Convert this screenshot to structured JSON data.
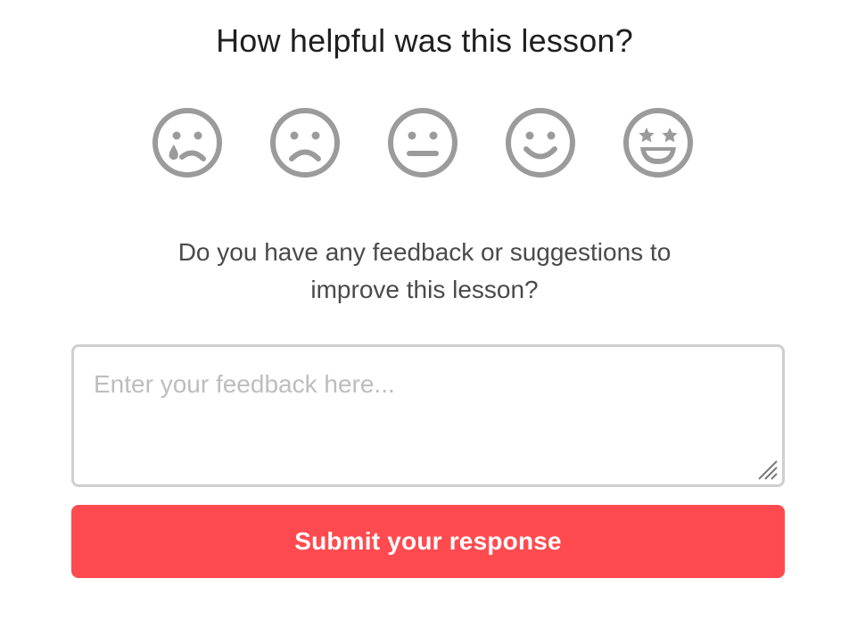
{
  "title": "How helpful was this lesson?",
  "ratings": [
    {
      "icon": "crying-face-icon",
      "color": "#9b9b9b"
    },
    {
      "icon": "sad-face-icon",
      "color": "#9b9b9b"
    },
    {
      "icon": "neutral-face-icon",
      "color": "#9b9b9b"
    },
    {
      "icon": "smiling-face-icon",
      "color": "#9b9b9b"
    },
    {
      "icon": "star-eyes-face-icon",
      "color": "#9b9b9b"
    }
  ],
  "question": {
    "line1": "Do you have any feedback or suggestions to",
    "line2": "improve this lesson?"
  },
  "feedback": {
    "value": "",
    "placeholder": "Enter your feedback here..."
  },
  "submit": {
    "label": "Submit your response",
    "color": "#ff4a4f"
  }
}
